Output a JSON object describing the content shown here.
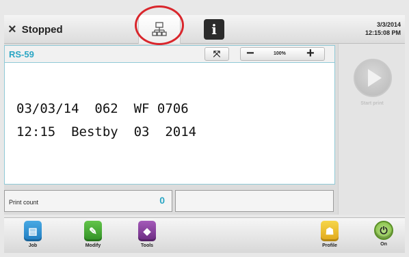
{
  "header": {
    "status_icon": "×",
    "status_text": "Stopped",
    "date": "3/3/2014",
    "time": "12:15:08 PM"
  },
  "tabs": {
    "network_icon": "network-icon",
    "info_icon": "i"
  },
  "message": {
    "name": "RS-59",
    "zoom": "100%",
    "zoom_minus": "−",
    "zoom_plus": "+",
    "move_icon": "⤧",
    "line1": "03/03/14  062  WF 0706",
    "line2": "12:15  Bestby  03  2014"
  },
  "side": {
    "start_print_label": "Start print"
  },
  "counters": {
    "print_count_label": "Print count",
    "print_count_value": "0"
  },
  "nav": [
    {
      "label": "Job",
      "icon": "▤"
    },
    {
      "label": "Modify",
      "icon": "✎"
    },
    {
      "label": "Tools",
      "icon": "◆"
    },
    {
      "label": "Profile",
      "icon": "☗"
    },
    {
      "label": "On",
      "icon": "⏻"
    }
  ],
  "colors": {
    "accent": "#2aa6c4",
    "highlight_ring": "#d9262c"
  }
}
